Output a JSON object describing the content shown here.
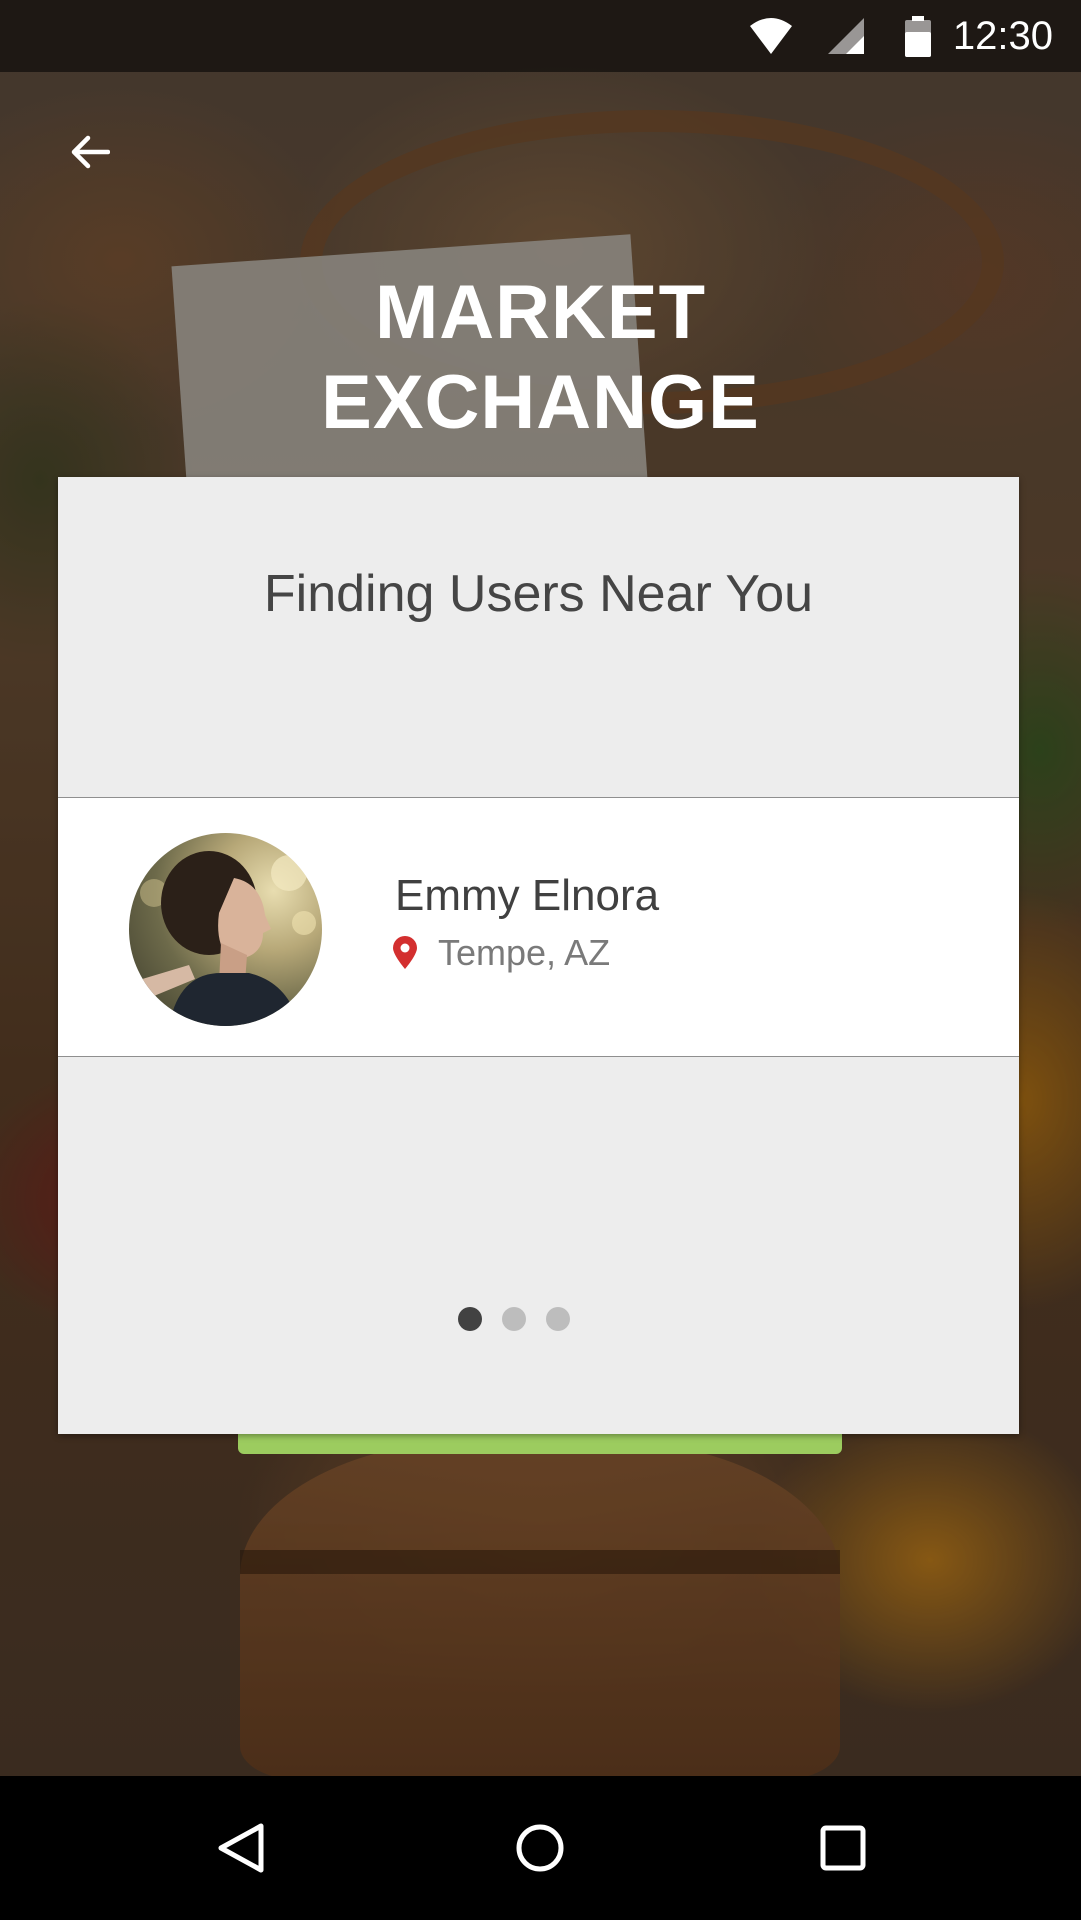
{
  "status_bar": {
    "time": "12:30",
    "icons": [
      "wifi-icon",
      "signal-icon",
      "battery-icon"
    ]
  },
  "header": {
    "back_icon": "arrow-left-icon",
    "title": "MARKET\nEXCHANGE"
  },
  "card": {
    "title": "Finding Users Near You",
    "user": {
      "name": "Emmy Elnora",
      "location": "Tempe, AZ",
      "location_icon": "location-pin-icon",
      "avatar": "user-avatar"
    },
    "pager": {
      "count": 3,
      "active_index": 0
    }
  },
  "nav_bar": {
    "buttons": [
      "back-triangle-icon",
      "home-circle-icon",
      "recents-square-icon"
    ]
  },
  "colors": {
    "accent_green": "#9ccc5f",
    "pin_red": "#d32f2f",
    "card_bg": "#ededed",
    "text_dark": "#404040",
    "text_muted": "#7a7a7a"
  }
}
